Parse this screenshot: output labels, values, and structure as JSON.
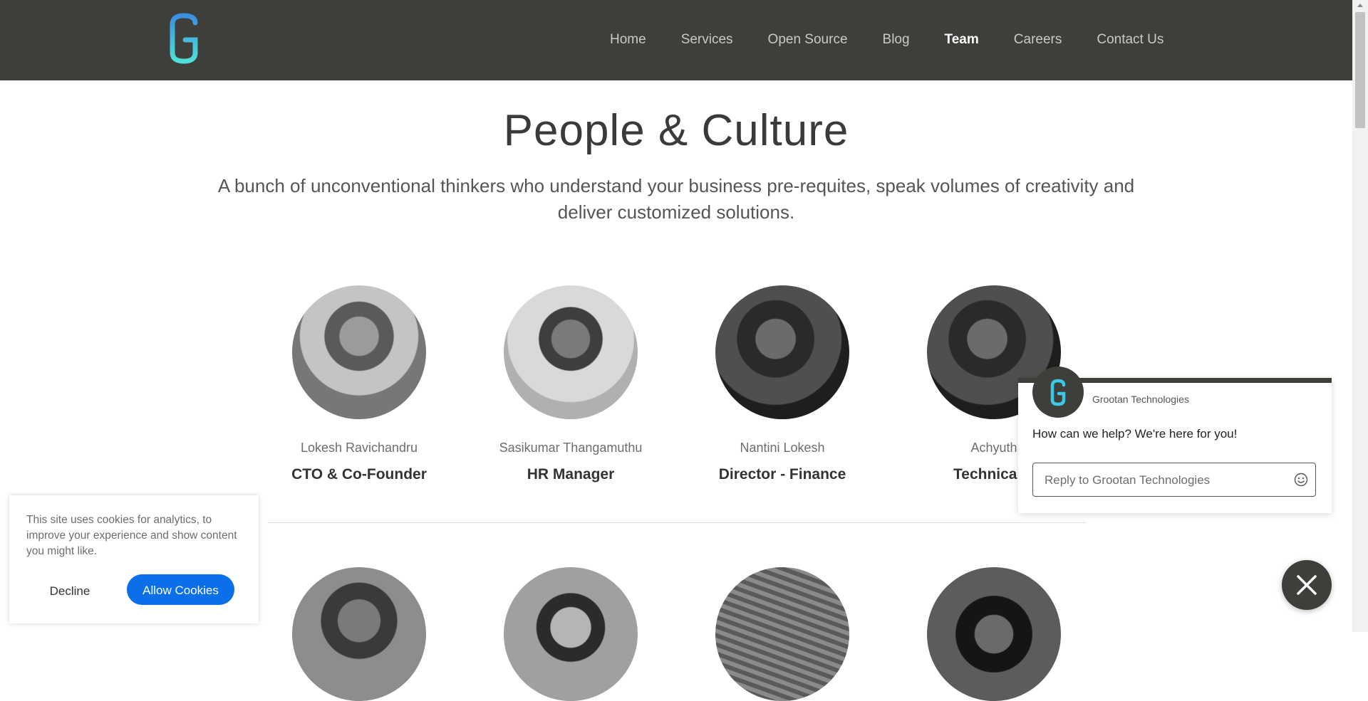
{
  "header": {
    "logo_letter": "G",
    "nav": [
      "Home",
      "Services",
      "Open Source",
      "Blog",
      "Team",
      "Careers",
      "Contact Us"
    ],
    "active_nav": "Team"
  },
  "hero": {
    "title": "People & Culture",
    "subtitle": "A bunch of unconventional thinkers who understand your business pre-requites, speak volumes of creativity and deliver customized solutions."
  },
  "team": [
    {
      "name": "Lokesh Ravichandru",
      "role": "CTO & Co-Founder"
    },
    {
      "name": "Sasikumar Thangamuthu",
      "role": "HR Manager"
    },
    {
      "name": "Nantini Lokesh",
      "role": "Director - Finance"
    },
    {
      "name": "Achyuth",
      "role": "Technical L"
    }
  ],
  "cookie": {
    "text": "This site uses cookies for analytics, to improve your experience and show content you might like.",
    "decline": "Decline",
    "allow": "Allow Cookies"
  },
  "chat": {
    "company": "Grootan Technologies",
    "message": "How can we help? We're here for you!",
    "placeholder": "Reply to Grootan Technologies"
  },
  "colors": {
    "header_bg": "#3e3e3b",
    "accent_blue": "#0a6fe8",
    "logo_cyan": "#3cc8e8"
  }
}
